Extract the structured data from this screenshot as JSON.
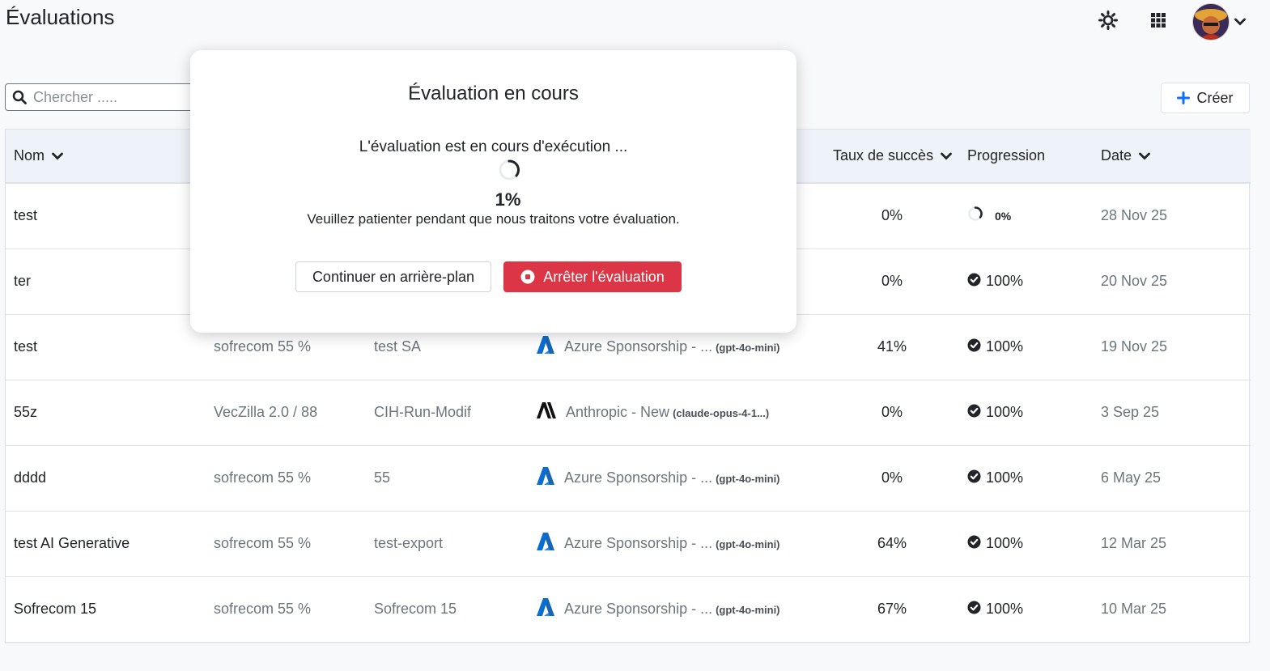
{
  "page": {
    "title": "Évaluations"
  },
  "header": {
    "theme_icon": "sun-icon",
    "apps_icon": "grid-icon",
    "avatar_icon": "avatar",
    "menu_icon": "chevron-down-icon"
  },
  "search": {
    "placeholder": "Chercher ....."
  },
  "toolbar": {
    "create_label": "Créer"
  },
  "table": {
    "columns": [
      "Nom",
      "",
      "",
      "",
      "Taux de succès",
      "Progression",
      "Date"
    ],
    "rows": [
      {
        "name": "test",
        "dataset": "",
        "config": "",
        "provider": "",
        "model": "",
        "provider_icon": "",
        "success": "0%",
        "progress": "0%",
        "progress_state": "running",
        "date": "28 Nov 25"
      },
      {
        "name": "ter",
        "dataset": "",
        "config": "",
        "provider": "",
        "model": "",
        "provider_icon": "",
        "success": "0%",
        "progress": "100%",
        "progress_state": "done",
        "date": "20 Nov 25"
      },
      {
        "name": "test",
        "dataset": "sofrecom 55 %",
        "config": "test SA",
        "provider": "Azure Sponsorship - ...",
        "model": "(gpt-4o-mini)",
        "provider_icon": "azure-icon",
        "success": "41%",
        "progress": "100%",
        "progress_state": "done",
        "date": "19 Nov 25"
      },
      {
        "name": "55z",
        "dataset": "VecZilla 2.0 / 88",
        "config": "CIH-Run-Modif",
        "provider": "Anthropic - New",
        "model": "(claude-opus-4-1...)",
        "provider_icon": "anthropic-icon",
        "success": "0%",
        "progress": "100%",
        "progress_state": "done",
        "date": "3 Sep 25"
      },
      {
        "name": "dddd",
        "dataset": "sofrecom 55 %",
        "config": "55",
        "provider": "Azure Sponsorship - ...",
        "model": "(gpt-4o-mini)",
        "provider_icon": "azure-icon",
        "success": "0%",
        "progress": "100%",
        "progress_state": "done",
        "date": "6 May 25"
      },
      {
        "name": "test AI Generative",
        "dataset": "sofrecom 55 %",
        "config": "test-export",
        "provider": "Azure Sponsorship - ...",
        "model": "(gpt-4o-mini)",
        "provider_icon": "azure-icon",
        "success": "64%",
        "progress": "100%",
        "progress_state": "done",
        "date": "12 Mar 25"
      },
      {
        "name": "Sofrecom 15",
        "dataset": "sofrecom 55 %",
        "config": "Sofrecom 15",
        "provider": "Azure Sponsorship - ...",
        "model": "(gpt-4o-mini)",
        "provider_icon": "azure-icon",
        "success": "67%",
        "progress": "100%",
        "progress_state": "done",
        "date": "10 Mar 25"
      }
    ]
  },
  "modal": {
    "title": "Évaluation en cours",
    "message": "L'évaluation est en cours d'exécution ...",
    "percent": "1%",
    "wait": "Veuillez patienter pendant que nous traitons votre évaluation.",
    "background_label": "Continuer en arrière-plan",
    "stop_label": "Arrêter l'évaluation"
  },
  "colors": {
    "danger": "#dc3545",
    "accent": "#0d6efd",
    "header_bg": "#eef2f9",
    "azure": "#0a6ed1"
  }
}
